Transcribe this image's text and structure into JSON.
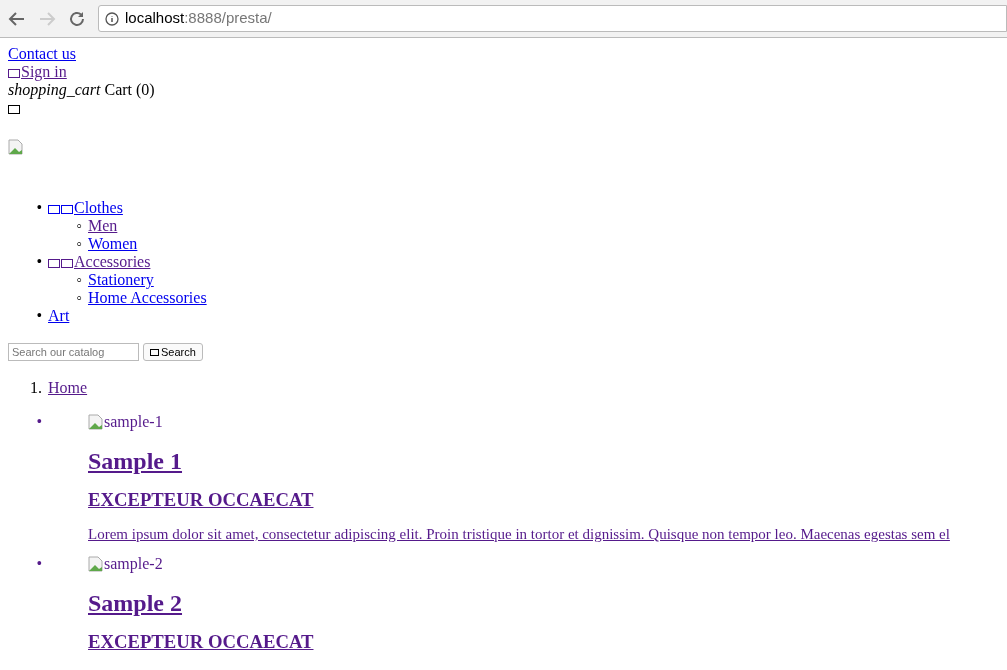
{
  "browser": {
    "url_host": "localhost",
    "url_path": ":8888/presta/"
  },
  "header": {
    "contact": {
      "label": "Contact us",
      "visited": false
    },
    "sign_in": {
      "label": "Sign in",
      "visited": true
    },
    "cart": {
      "icon_text": "shopping_cart",
      "label": "Cart (0)"
    }
  },
  "menu": [
    {
      "marker": "•",
      "label": "Clothes",
      "visited": false,
      "icon_boxes": true,
      "children": [
        {
          "marker": "◦",
          "label": "Men",
          "visited": true
        },
        {
          "marker": "◦",
          "label": "Women",
          "visited": false
        }
      ]
    },
    {
      "marker": "•",
      "label": "Accessories",
      "visited": true,
      "icon_boxes": true,
      "children": [
        {
          "marker": "◦",
          "label": "Stationery",
          "visited": false
        },
        {
          "marker": "◦",
          "label": "Home Accessories",
          "visited": false
        }
      ]
    },
    {
      "marker": "•",
      "label": "Art",
      "visited": false,
      "icon_boxes": false
    }
  ],
  "search": {
    "placeholder": "Search our catalog",
    "button": "Search"
  },
  "breadcrumb": [
    {
      "marker": "1.",
      "label": "Home",
      "visited": true
    }
  ],
  "slides": [
    {
      "marker": "•",
      "alt": "sample-1",
      "title": "Sample 1",
      "subtitle": "EXCEPTEUR OCCAECAT",
      "text": "Lorem ipsum dolor sit amet, consectetur adipiscing elit. Proin tristique in tortor et dignissim. Quisque non tempor leo. Maecenas egestas sem el",
      "visited": true
    },
    {
      "marker": "•",
      "alt": "sample-2",
      "title": "Sample 2",
      "subtitle": "EXCEPTEUR OCCAECAT",
      "visited": true
    }
  ]
}
